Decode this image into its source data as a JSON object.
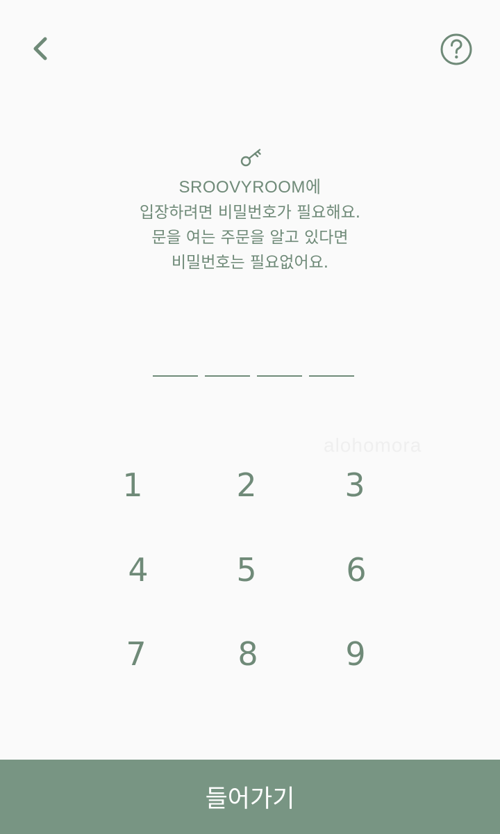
{
  "header": {
    "back_icon": "chevron-left-icon",
    "help_icon": "question-circle-icon"
  },
  "intro": {
    "icon": "key-icon",
    "lines": [
      "SROOVYROOM에",
      "입장하려면 비밀번호가 필요해요.",
      "문을 여는 주문을 알고 있다면",
      "비밀번호는 필요없어요."
    ]
  },
  "pin": {
    "length": 4
  },
  "watermark": "alohomora",
  "keypad": {
    "keys": [
      "1",
      "2",
      "3",
      "4",
      "5",
      "6",
      "7",
      "8",
      "9"
    ]
  },
  "footer": {
    "enter_label": "들어가기"
  },
  "colors": {
    "accent": "#789583",
    "text": "#6f8a78",
    "background": "#fafafa"
  }
}
